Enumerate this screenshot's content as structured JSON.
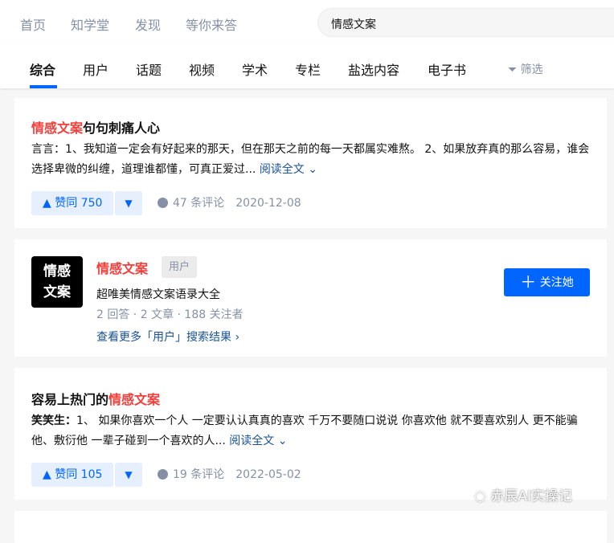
{
  "header": {
    "nav": [
      "首页",
      "知学堂",
      "发现",
      "等你来答"
    ],
    "search_value": "情感文案"
  },
  "tabs": {
    "items": [
      "综合",
      "用户",
      "话题",
      "视频",
      "学术",
      "专栏",
      "盐选内容",
      "电子书"
    ],
    "filter": "筛选"
  },
  "results": [
    {
      "title_hl": "情感文案",
      "title_rest": "句句刺痛人心",
      "author": "言言：",
      "excerpt": "1、我知道一定会有好起来的那天，但在那天之前的每一天都属实难熬。 2、如果放弃真的那么容易，谁会选择卑微的纠缠，道理谁都懂，可真正爱过...",
      "read_more": "阅读全文",
      "vote": "▲ 赞同 750",
      "comments": "47 条评论",
      "date": "2020-12-08"
    },
    {
      "title_pre": "容易上热门的",
      "title_hl": "情感文案",
      "author": "笑笑生：",
      "excerpt": "1、 如果你喜欢一个人 一定要认认真真的喜欢 千万不要随口说说 你喜欢他 就不要喜欢别人 更不能骗他、敷衍他 一辈子碰到一个喜欢的人...",
      "read_more": "阅读全文",
      "vote": "▲ 赞同 105",
      "comments": "19 条评论",
      "date": "2022-05-02"
    }
  ],
  "user_card": {
    "avatar_text": "情感文案",
    "name": "情感文案",
    "badge": "用户",
    "bio": "超唯美情感文案语录大全",
    "stats": "2 回答 · 2 文章 · 188 关注者",
    "more_link": "查看更多「用户」搜索结果 ›",
    "follow": "关注她"
  },
  "watermark": "赤辰AI实操记"
}
